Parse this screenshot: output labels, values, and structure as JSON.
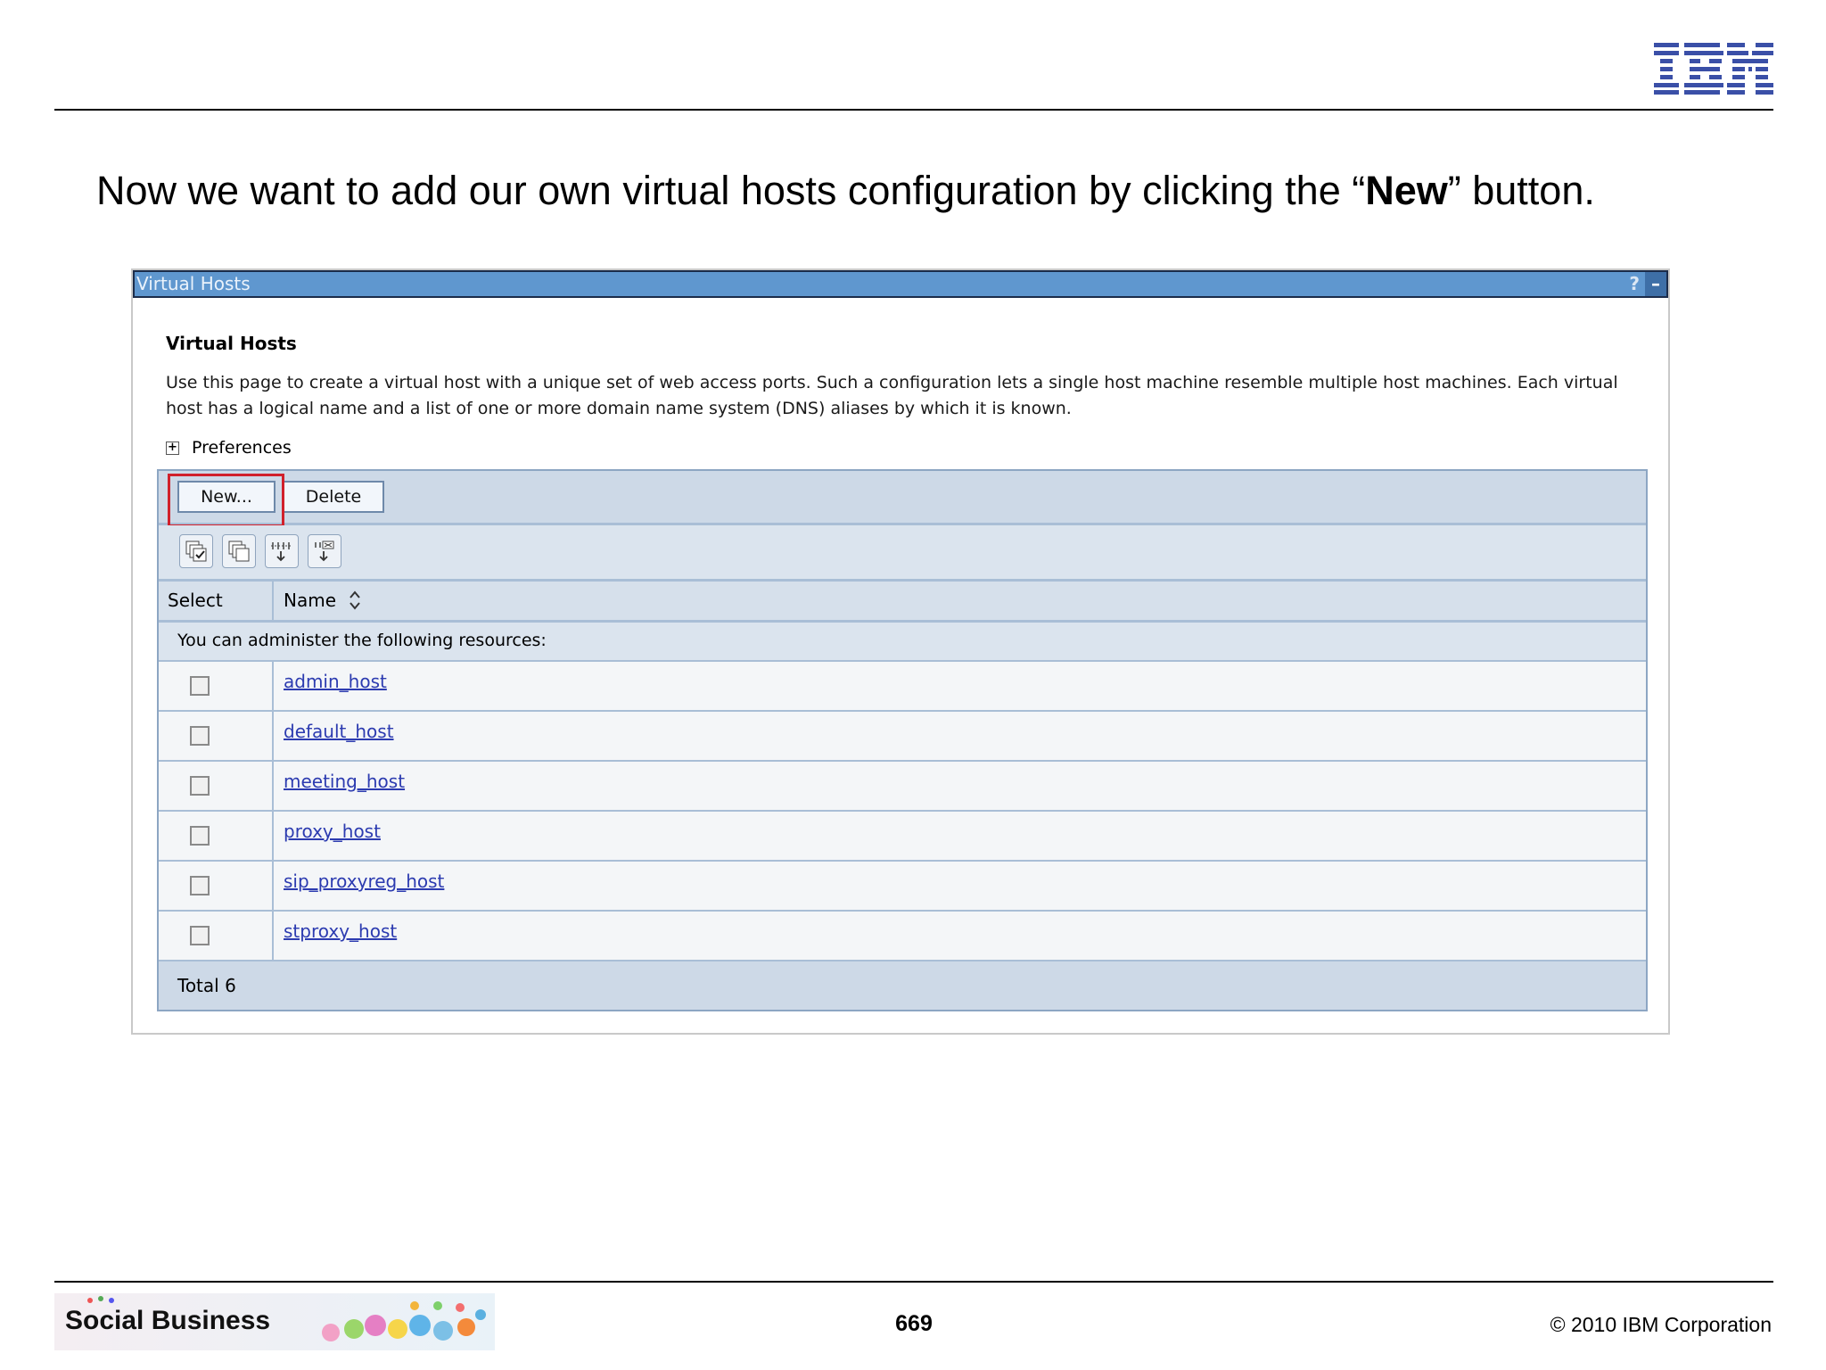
{
  "slide": {
    "headline_prefix": "Now we want to add our own virtual hosts configuration by clicking the “",
    "headline_bold": "New",
    "headline_suffix": "” button.",
    "logo": "IBM",
    "footer_brand": "Social Business",
    "page_number": "669",
    "copyright": "© 2010 IBM Corporation"
  },
  "panel": {
    "title": "Virtual Hosts",
    "help": "?",
    "minimize": "–",
    "section_title": "Virtual Hosts",
    "description": "Use this page to create a virtual host with a unique set of web access ports. Such a configuration lets a single host machine resemble multiple host machines. Each virtual host has a logical name and a list of one or more domain name system (DNS) aliases by which it is known.",
    "preferences_label": "Preferences",
    "buttons": {
      "new": "New...",
      "delete": "Delete"
    },
    "toolbar_icons": [
      "select-all-icon",
      "deselect-all-icon",
      "show-filter-icon",
      "clear-filter-icon"
    ],
    "columns": {
      "select": "Select",
      "name": "Name"
    },
    "info": "You can administer the following resources:",
    "rows": [
      {
        "name": "admin_host"
      },
      {
        "name": "default_host"
      },
      {
        "name": "meeting_host"
      },
      {
        "name": "proxy_host"
      },
      {
        "name": "sip_proxyreg_host"
      },
      {
        "name": "stproxy_host"
      }
    ],
    "total": "Total 6"
  },
  "colors": {
    "title_bar": "#5f97cf",
    "highlight": "#d1202b",
    "link": "#2c3bb0"
  }
}
